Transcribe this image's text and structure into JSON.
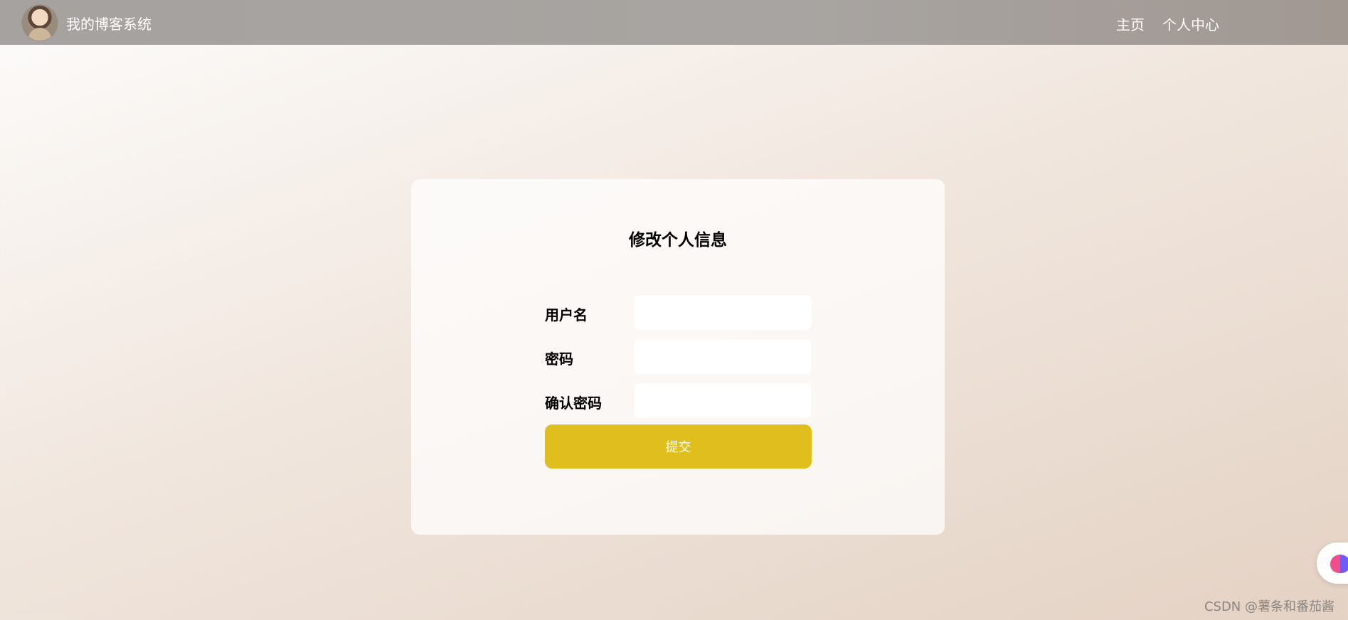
{
  "header": {
    "brand_title": "我的博客系统",
    "avatar": "avatar-photo",
    "nav": [
      {
        "label": "主页"
      },
      {
        "label": "个人中心"
      }
    ]
  },
  "form": {
    "title": "修改个人信息",
    "fields": [
      {
        "label": "用户名",
        "value": "",
        "placeholder": ""
      },
      {
        "label": "密码",
        "value": "",
        "placeholder": ""
      },
      {
        "label": "确认密码",
        "value": "",
        "placeholder": ""
      }
    ],
    "submit_label": "提交",
    "accent_color": "#dfbe1e"
  },
  "floating_widget": {
    "icon": "brain-icon"
  },
  "watermark": "CSDN @薯条和番茄酱"
}
